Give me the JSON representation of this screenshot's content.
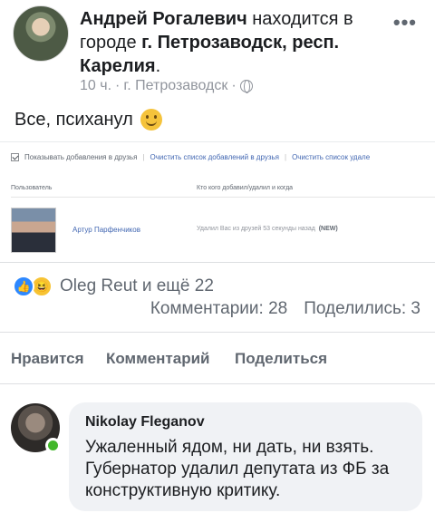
{
  "post": {
    "author": "Андрей Рогалевич",
    "author_suffix": "находится в городе",
    "location": "г. Петрозаводск, респ. Карелия",
    "location_end": ".",
    "time": "10 ч.",
    "place": "г. Петрозаводск",
    "separator": "·",
    "more_label": "•••",
    "text": "Все, психанул",
    "emoji_icon": "smiley-icon"
  },
  "screenshot": {
    "toolbar": {
      "show_label": "Показывать добавления в друзья",
      "link1": "Очистить список добавлений в друзья",
      "link2": "Очистить список удале",
      "sep": "|"
    },
    "headers": {
      "user": "Пользователь",
      "who": "Кто кого добавил/удалил и когда"
    },
    "row": {
      "name": "Артур Парфенчиков",
      "action": "Удалил Вас из друзей 53 секунды назад",
      "badge": "(NEW)"
    }
  },
  "reactions": {
    "names": "Oleg Reut и ещё 22",
    "comments": "Комментарии: 28",
    "shares": "Поделились: 3",
    "like_icon": "👍",
    "haha_icon": "😆"
  },
  "actions": {
    "like": "Нравится",
    "comment": "Комментарий",
    "share": "Поделиться"
  },
  "comment": {
    "author": "Nikolay Fleganov",
    "text": "Ужаленный ядом, ни дать, ни взять. Губернатор удалил депутата из ФБ за конструктивную критику."
  }
}
